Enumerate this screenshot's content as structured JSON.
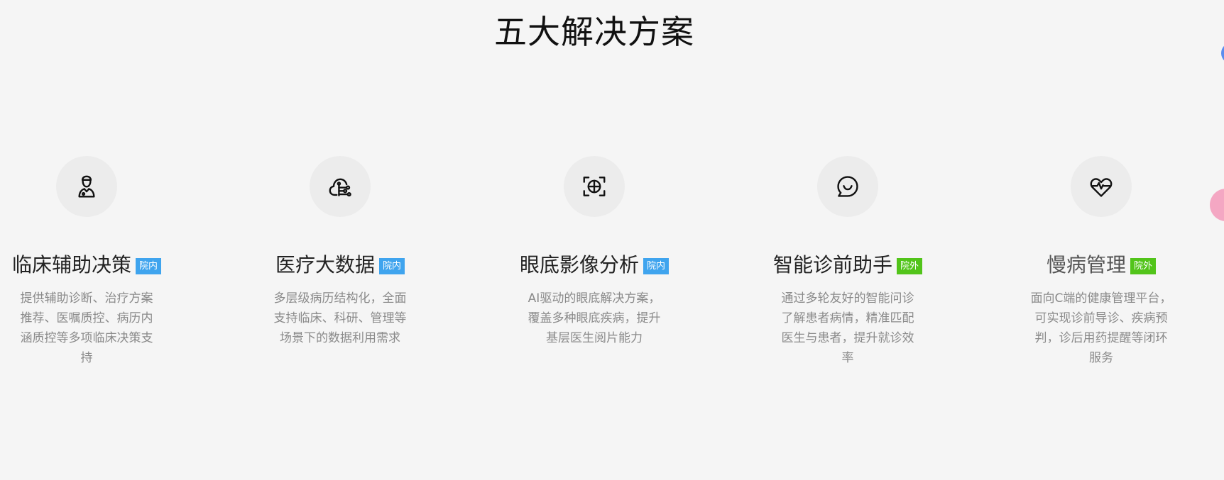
{
  "section": {
    "title": "五大解决方案"
  },
  "solutions": [
    {
      "icon": "doctor-icon",
      "title": "临床辅助决策",
      "badge": "院内",
      "badge_color": "#3fa4ee",
      "desc": "提供辅助诊断、治疗方案推荐、医嘱质控、病历内涵质控等多项临床决策支持"
    },
    {
      "icon": "cloud-data-icon",
      "title": "医疗大数据",
      "badge": "院内",
      "badge_color": "#3fa4ee",
      "desc": "多层级病历结构化，全面支持临床、科研、管理等场景下的数据利用需求"
    },
    {
      "icon": "eye-scan-icon",
      "title": "眼底影像分析",
      "badge": "院内",
      "badge_color": "#3fa4ee",
      "desc": "AI驱动的眼底解决方案，覆盖多种眼底疾病，提升基层医生阅片能力"
    },
    {
      "icon": "chat-smile-icon",
      "title": "智能诊前助手",
      "badge": "院外",
      "badge_color": "#52c41a",
      "desc": "通过多轮友好的智能问诊了解患者病情，精准匹配医生与患者，提升就诊效率"
    },
    {
      "icon": "heart-pulse-icon",
      "title": "慢病管理",
      "badge": "院外",
      "badge_color": "#52c41a",
      "desc": "面向C端的健康管理平台，可实现诊前导诊、疾病预判，诊后用药提醒等闭环服务"
    }
  ],
  "colors": {
    "background": "#f5f5f5",
    "icon_circle": "#ececec",
    "badge_inside": "#3fa4ee",
    "badge_outside": "#52c41a",
    "float_blue": "#5b8def",
    "float_pink": "#f4a7c3"
  }
}
